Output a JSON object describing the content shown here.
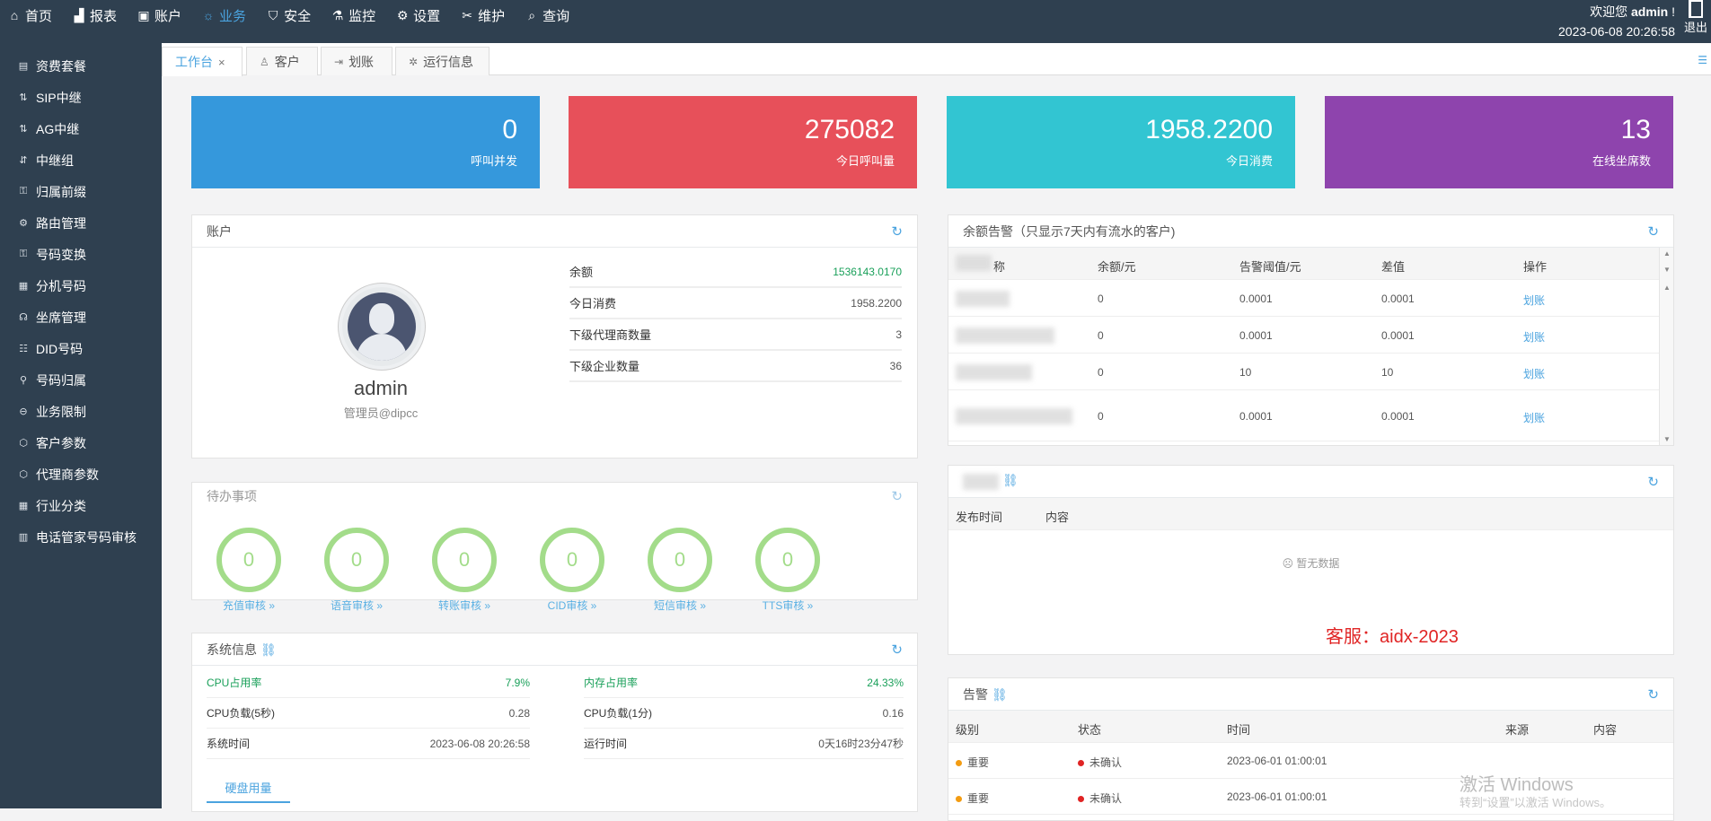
{
  "topnav": [
    {
      "icon": "home-icon",
      "glyph": "⌂",
      "label": "首页"
    },
    {
      "icon": "chart-icon",
      "glyph": "▟",
      "label": "报表"
    },
    {
      "icon": "account-icon",
      "glyph": "▣",
      "label": "账户"
    },
    {
      "icon": "business-icon",
      "glyph": "☼",
      "label": "业务",
      "active": true
    },
    {
      "icon": "shield-icon",
      "glyph": "⛉",
      "label": "安全"
    },
    {
      "icon": "monitor-icon",
      "glyph": "⚗",
      "label": "监控"
    },
    {
      "icon": "gear-icon",
      "glyph": "⚙",
      "label": "设置"
    },
    {
      "icon": "wrench-icon",
      "glyph": "✂",
      "label": "维护"
    },
    {
      "icon": "search-icon",
      "glyph": "⌕",
      "label": "查询"
    }
  ],
  "header": {
    "welcome_prefix": "欢迎您",
    "username": "admin",
    "welcome_suffix": "!",
    "datetime": "2023-06-08 20:26:58",
    "logout": "退出"
  },
  "sidebar": [
    {
      "icon": "package-icon",
      "glyph": "▤",
      "label": "资费套餐"
    },
    {
      "icon": "trunk-icon",
      "glyph": "⇅",
      "label": "SIP中继"
    },
    {
      "icon": "trunk-icon",
      "glyph": "⇅",
      "label": "AG中继"
    },
    {
      "icon": "trunk-group-icon",
      "glyph": "⇵",
      "label": "中继组"
    },
    {
      "icon": "prefix-icon",
      "glyph": "⚿",
      "label": "归属前缀"
    },
    {
      "icon": "route-icon",
      "glyph": "⚙",
      "label": "路由管理"
    },
    {
      "icon": "number-transform-icon",
      "glyph": "⚿",
      "label": "号码变换"
    },
    {
      "icon": "extension-icon",
      "glyph": "▦",
      "label": "分机号码"
    },
    {
      "icon": "seat-icon",
      "glyph": "☊",
      "label": "坐席管理"
    },
    {
      "icon": "did-icon",
      "glyph": "☷",
      "label": "DID号码"
    },
    {
      "icon": "location-icon",
      "glyph": "⚲",
      "label": "号码归属"
    },
    {
      "icon": "limit-icon",
      "glyph": "⊖",
      "label": "业务限制"
    },
    {
      "icon": "customer-param-icon",
      "glyph": "⬡",
      "label": "客户参数"
    },
    {
      "icon": "agent-param-icon",
      "glyph": "⬡",
      "label": "代理商参数"
    },
    {
      "icon": "industry-icon",
      "glyph": "▦",
      "label": "行业分类"
    },
    {
      "icon": "audit-icon",
      "glyph": "▥",
      "label": "电话管家号码审核"
    }
  ],
  "tabs": [
    {
      "label": "工作台",
      "close": "×",
      "active": true
    },
    {
      "icon": "user-icon",
      "glyph": "♙",
      "label": "客户"
    },
    {
      "icon": "transfer-icon",
      "glyph": "⇥",
      "label": "划账"
    },
    {
      "icon": "gear-icon",
      "glyph": "✲",
      "label": "运行信息"
    }
  ],
  "stats": [
    {
      "value": "0",
      "label": "呼叫并发",
      "color": "#3598dc"
    },
    {
      "value": "275082",
      "label": "今日呼叫量",
      "color": "#e7505a"
    },
    {
      "value": "1958.2200",
      "label": "今日消费",
      "color": "#32c5d2"
    },
    {
      "value": "13",
      "label": "在线坐席数",
      "color": "#8e44ad"
    }
  ],
  "account": {
    "title": "账户",
    "name": "admin",
    "role": "管理员@dipcc",
    "rows": [
      {
        "key": "余额",
        "value": "1536143.0170",
        "green": true
      },
      {
        "key": "今日消费",
        "value": "1958.2200"
      },
      {
        "key": "下级代理商数量",
        "value": "3"
      },
      {
        "key": "下级企业数量",
        "value": "36"
      }
    ]
  },
  "todo": {
    "title": "待办事项",
    "items": [
      {
        "count": "0",
        "label": "充值审核 »"
      },
      {
        "count": "0",
        "label": "语音审核 »"
      },
      {
        "count": "0",
        "label": "转账审核 »"
      },
      {
        "count": "0",
        "label": "CID审核 »"
      },
      {
        "count": "0",
        "label": "短信审核 »"
      },
      {
        "count": "0",
        "label": "TTS审核 »"
      }
    ]
  },
  "sysinfo": {
    "title": "系统信息",
    "left": [
      {
        "key": "CPU占用率",
        "value": "7.9%",
        "green": true
      },
      {
        "key": "CPU负载(5秒)",
        "value": "0.28"
      },
      {
        "key": "系统时间",
        "value": "2023-06-08 20:26:58"
      }
    ],
    "right": [
      {
        "key": "内存占用率",
        "value": "24.33%",
        "green": true
      },
      {
        "key": "CPU负载(1分)",
        "value": "0.16"
      },
      {
        "key": "运行时间",
        "value": "0天16时23分47秒"
      }
    ],
    "disk_tab": "硬盘用量"
  },
  "balance_alert": {
    "title": "余额告警（只显示7天内有流水的客户)",
    "headers": [
      "称",
      "余额/元",
      "告警阈值/元",
      "差值",
      "操作"
    ],
    "rows": [
      {
        "balance": "0",
        "threshold": "0.0001",
        "diff": "0.0001",
        "op": "划账"
      },
      {
        "balance": "0",
        "threshold": "0.0001",
        "diff": "0.0001",
        "op": "划账"
      },
      {
        "balance": "0",
        "threshold": "10",
        "diff": "10",
        "op": "划账"
      },
      {
        "balance": "0",
        "threshold": "0.0001",
        "diff": "0.0001",
        "op": "划账"
      }
    ]
  },
  "notice": {
    "headers": [
      "发布时间",
      "内容"
    ],
    "empty": "暂无数据",
    "kefu": "客服：aidx-2023"
  },
  "alarm": {
    "title": "告警",
    "headers": [
      "级别",
      "状态",
      "时间",
      "来源",
      "内容"
    ],
    "rows": [
      {
        "level": "重要",
        "status": "未确认",
        "time": "2023-06-01 01:00:01"
      },
      {
        "level": "重要",
        "status": "未确认",
        "time": "2023-06-01 01:00:01"
      }
    ]
  },
  "watermark": {
    "line1": "激活 Windows",
    "line2": "转到“设置”以激活 Windows。"
  }
}
